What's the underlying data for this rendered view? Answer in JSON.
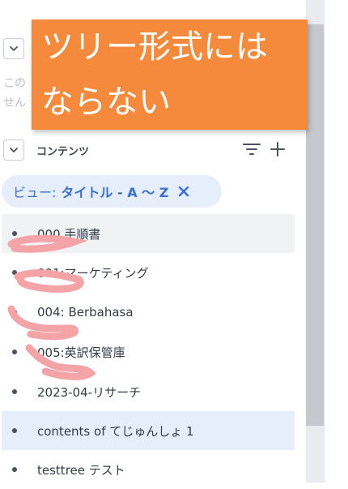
{
  "callout": {
    "line1": "ツリー形式には",
    "line2": "ならない"
  },
  "faded_text": {
    "line1": "この",
    "line2": "せん"
  },
  "contents_section": {
    "label": "コンテンツ"
  },
  "view_filter": {
    "label": "ビュー:",
    "value": "タイトル - A 〜 Z"
  },
  "items": [
    {
      "label": "000.手順書",
      "state": "hover"
    },
    {
      "label": "001:マーケティング",
      "state": "normal"
    },
    {
      "label": "004: Berbahasa",
      "state": "normal"
    },
    {
      "label": "005:英訳保管庫",
      "state": "normal"
    },
    {
      "label": "2023-04-リサーチ",
      "state": "normal"
    },
    {
      "label": "contents of てじゅんしょ 1",
      "state": "selected"
    },
    {
      "label": "testtree テスト",
      "state": "normal"
    }
  ],
  "colors": {
    "callout_bg": "#f58a3c",
    "accent_blue": "#3a6fd1",
    "pill_bg": "#e6eefb",
    "scribble_pink": "#f4a3a6"
  }
}
